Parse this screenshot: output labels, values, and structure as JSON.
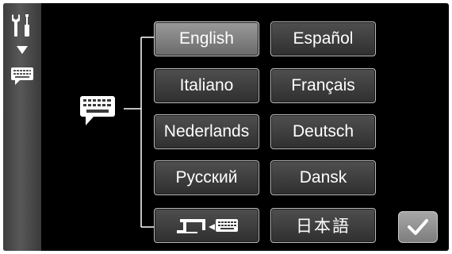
{
  "languages": {
    "english": "English",
    "espanol": "Español",
    "italiano": "Italiano",
    "francais": "Français",
    "nederlands": "Nederlands",
    "deutsch": "Deutsch",
    "russian": "Русский",
    "dansk": "Dansk",
    "japanese": "日本語"
  },
  "selected_language": "English",
  "icons": {
    "sidebar_tools": "wrench-screwdriver-icon",
    "sidebar_arrow": "triangle-down-icon",
    "sidebar_keyboard": "keyboard-speech-icon",
    "language_icon": "keyboard-speech-icon",
    "machine_language": "sewing-machine-keyboard-icon",
    "confirm": "checkmark-icon"
  },
  "colors": {
    "screen_bg": "#000000",
    "button_bg": "#3c3c3c",
    "selected_button_bg": "#8a8a8a",
    "text": "#ffffff"
  }
}
